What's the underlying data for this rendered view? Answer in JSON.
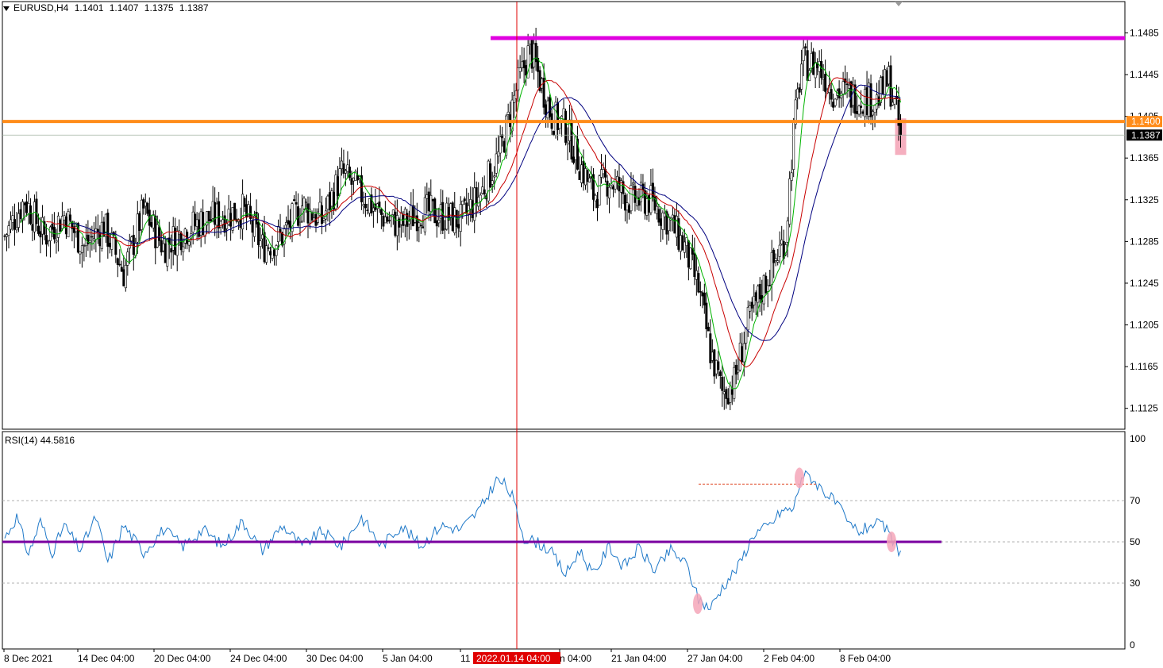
{
  "header": {
    "symbol": "EURUSD,H4",
    "open": "1.1401",
    "high": "1.1407",
    "low": "1.1375",
    "close": "1.1387"
  },
  "rsi_header": {
    "label": "RSI(14)",
    "value": "44.5816"
  },
  "crosshair_date_label": "2022.01.14 04:00",
  "price_box_levels": {
    "orange": "1.1400",
    "current": "1.1387"
  },
  "colors": {
    "background": "#ffffff",
    "candle": "#000000",
    "ma_fast": "#00b400",
    "ma_mid": "#c80000",
    "ma_slow": "#00007f",
    "resistance": "#e000e0",
    "support": "#ff8c1a",
    "rsi_line": "#1e78c8",
    "rsi_midline": "#7a00a0",
    "crosshair": "#e00000",
    "highlight": "#f4a6b8"
  },
  "chart_data": [
    {
      "type": "candlestick",
      "title": "EURUSD,H4",
      "ylim": [
        1.1105,
        1.1515
      ],
      "yticks": [
        "1.1485",
        "1.1445",
        "1.1405",
        "1.1365",
        "1.1325",
        "1.1285",
        "1.1245",
        "1.1205",
        "1.1165",
        "1.1125"
      ],
      "xticks": [
        "8 Dec 2021",
        "14 Dec 04:00",
        "20 Dec 04:00",
        "24 Dec 04:00",
        "30 Dec 04:00",
        "5 Jan 04:00",
        "11",
        "n 04:00",
        "21 Jan 04:00",
        "27 Jan 04:00",
        "2 Feb 04:00",
        "8 Feb 04:00"
      ],
      "anchor_closes": [
        [
          0,
          1.129
        ],
        [
          10,
          1.1325
        ],
        [
          20,
          1.129
        ],
        [
          30,
          1.131
        ],
        [
          40,
          1.128
        ],
        [
          50,
          1.13
        ],
        [
          60,
          1.1255
        ],
        [
          70,
          1.1315
        ],
        [
          80,
          1.128
        ],
        [
          90,
          1.1295
        ],
        [
          100,
          1.1305
        ],
        [
          110,
          1.131
        ],
        [
          120,
          1.1315
        ],
        [
          130,
          1.128
        ],
        [
          140,
          1.129
        ],
        [
          150,
          1.132
        ],
        [
          160,
          1.1305
        ],
        [
          170,
          1.135
        ],
        [
          180,
          1.133
        ],
        [
          190,
          1.131
        ],
        [
          200,
          1.13
        ],
        [
          210,
          1.1315
        ],
        [
          220,
          1.131
        ],
        [
          230,
          1.1305
        ],
        [
          240,
          1.133
        ],
        [
          250,
          1.137
        ],
        [
          258,
          1.143
        ],
        [
          265,
          1.147
        ],
        [
          270,
          1.144
        ],
        [
          276,
          1.1405
        ],
        [
          283,
          1.1395
        ],
        [
          290,
          1.136
        ],
        [
          297,
          1.133
        ],
        [
          305,
          1.1345
        ],
        [
          315,
          1.1325
        ],
        [
          325,
          1.1325
        ],
        [
          335,
          1.1305
        ],
        [
          343,
          1.128
        ],
        [
          350,
          1.124
        ],
        [
          356,
          1.118
        ],
        [
          362,
          1.114
        ],
        [
          368,
          1.115
        ],
        [
          374,
          1.12
        ],
        [
          380,
          1.123
        ],
        [
          387,
          1.126
        ],
        [
          394,
          1.129
        ],
        [
          398,
          1.139
        ],
        [
          402,
          1.1455
        ],
        [
          410,
          1.1455
        ],
        [
          418,
          1.143
        ],
        [
          428,
          1.1425
        ],
        [
          440,
          1.142
        ],
        [
          446,
          1.144
        ],
        [
          450,
          1.1405
        ],
        [
          452,
          1.1385
        ]
      ],
      "horizontal_lines": [
        {
          "name": "resistance",
          "price": 1.148
        },
        {
          "name": "support",
          "price": 1.14
        }
      ],
      "moving_averages": [
        {
          "name": "ma_fast",
          "period": 8
        },
        {
          "name": "ma_mid",
          "period": 21
        },
        {
          "name": "ma_slow",
          "period": 34
        }
      ]
    },
    {
      "type": "line",
      "title": "RSI(14) 44.5816",
      "ylim": [
        0,
        100
      ],
      "yticks": [
        "100",
        "70",
        "50",
        "30",
        "0"
      ],
      "levels": [
        70,
        50,
        30
      ],
      "anchors": [
        [
          0,
          52
        ],
        [
          6,
          62
        ],
        [
          12,
          44
        ],
        [
          18,
          60
        ],
        [
          24,
          45
        ],
        [
          30,
          58
        ],
        [
          38,
          46
        ],
        [
          46,
          62
        ],
        [
          52,
          40
        ],
        [
          60,
          58
        ],
        [
          70,
          45
        ],
        [
          80,
          56
        ],
        [
          90,
          48
        ],
        [
          100,
          56
        ],
        [
          110,
          48
        ],
        [
          120,
          60
        ],
        [
          130,
          46
        ],
        [
          140,
          58
        ],
        [
          150,
          48
        ],
        [
          160,
          55
        ],
        [
          170,
          48
        ],
        [
          180,
          62
        ],
        [
          190,
          48
        ],
        [
          200,
          58
        ],
        [
          210,
          48
        ],
        [
          220,
          58
        ],
        [
          230,
          56
        ],
        [
          240,
          66
        ],
        [
          248,
          80
        ],
        [
          252,
          78
        ],
        [
          256,
          72
        ],
        [
          262,
          52
        ],
        [
          268,
          50
        ],
        [
          275,
          46
        ],
        [
          283,
          34
        ],
        [
          290,
          46
        ],
        [
          297,
          34
        ],
        [
          305,
          48
        ],
        [
          312,
          38
        ],
        [
          320,
          47
        ],
        [
          328,
          36
        ],
        [
          336,
          46
        ],
        [
          344,
          39
        ],
        [
          350,
          22
        ],
        [
          356,
          18
        ],
        [
          362,
          28
        ],
        [
          370,
          38
        ],
        [
          378,
          54
        ],
        [
          386,
          58
        ],
        [
          392,
          65
        ],
        [
          398,
          66
        ],
        [
          402,
          82
        ],
        [
          406,
          82
        ],
        [
          412,
          76
        ],
        [
          420,
          68
        ],
        [
          426,
          58
        ],
        [
          432,
          55
        ],
        [
          438,
          59
        ],
        [
          444,
          57
        ],
        [
          448,
          50
        ],
        [
          452,
          45
        ]
      ],
      "dashed_reference": {
        "name": "rsi_peak_reference",
        "value": 78
      },
      "highlights": [
        {
          "name": "rsi-low-marker",
          "value": 20
        },
        {
          "name": "rsi-high-marker",
          "value": 81
        },
        {
          "name": "rsi-current-marker",
          "value": 50
        }
      ]
    }
  ]
}
